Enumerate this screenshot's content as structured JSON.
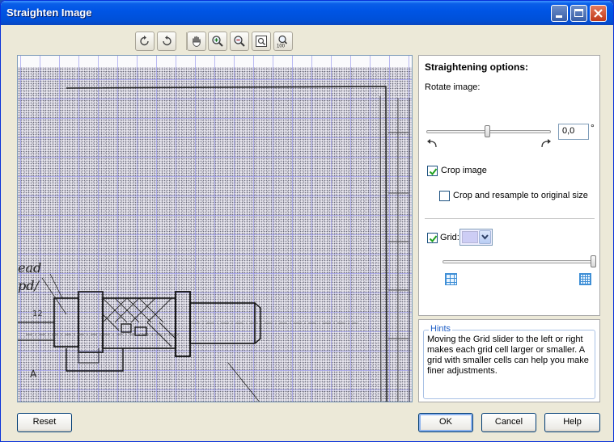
{
  "window": {
    "title": "Straighten Image"
  },
  "toolbar": {
    "items": [
      {
        "name": "rotate-left-icon"
      },
      {
        "name": "rotate-right-icon"
      },
      {
        "name": "pan-hand-icon"
      },
      {
        "name": "zoom-in-icon"
      },
      {
        "name": "zoom-out-icon"
      },
      {
        "name": "fit-to-window-icon"
      },
      {
        "name": "zoom-100-icon",
        "label": "100"
      }
    ]
  },
  "options": {
    "title": "Straightening options:",
    "rotate_label": "Rotate image:",
    "rotate_value": "0,0",
    "rotate_unit": "°",
    "crop_image_label": "Crop image",
    "crop_image_checked": true,
    "crop_resample_label": "Crop and resample to original size",
    "crop_resample_checked": false,
    "grid_label": "Grid:",
    "grid_checked": true,
    "grid_color": "#cdcdf5",
    "grid_slider_fraction": 1.0,
    "rotate_slider_fraction": 0.5
  },
  "hints": {
    "title": "Hints",
    "text": "Moving the Grid slider to the left or right makes each grid cell larger or smaller. A grid with smaller cells can help you make finer adjustments."
  },
  "buttons": {
    "reset": "Reset",
    "ok": "OK",
    "cancel": "Cancel",
    "help": "Help"
  },
  "preview": {
    "drawing_text": [
      "ead",
      "pd/",
      "A",
      "12"
    ]
  }
}
